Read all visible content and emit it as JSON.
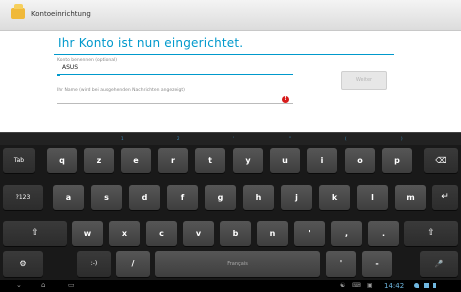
{
  "action_bar": {
    "title": "Kontoeinrichtung"
  },
  "content": {
    "heading": "Ihr Konto ist nun eingerichtet.",
    "account_name_label": "Konto benennen (optional)",
    "account_name_value": "ASUS",
    "your_name_label": "Ihr Name (wird bei ausgehenden Nachrichten angezeigt)",
    "next_button": "Weiter"
  },
  "keyboard": {
    "row1": [
      "Tab",
      "q",
      "z",
      "e",
      "r",
      "t",
      "y",
      "u",
      "i",
      "o",
      "p",
      "⌫"
    ],
    "row2": [
      "?123",
      "a",
      "s",
      "d",
      "f",
      "g",
      "h",
      "j",
      "k",
      "l",
      "m",
      "↵"
    ],
    "row3": [
      "⇧",
      "w",
      "x",
      "c",
      "v",
      "b",
      "n",
      "'",
      ",",
      ".",
      "⇧"
    ],
    "row4": {
      "settings": "⚙",
      "smiley": ":-)",
      "slash": "/",
      "space": "Français",
      "apostrophe": "'",
      "dash": "-",
      "mic": "🎤"
    },
    "hints": [
      "1",
      "2",
      "'",
      "\"",
      "(",
      ")",
      "!",
      "?"
    ]
  },
  "system_bar": {
    "clock": "14:42"
  },
  "colors": {
    "accent": "#0099cc",
    "error": "#d71a1a"
  }
}
